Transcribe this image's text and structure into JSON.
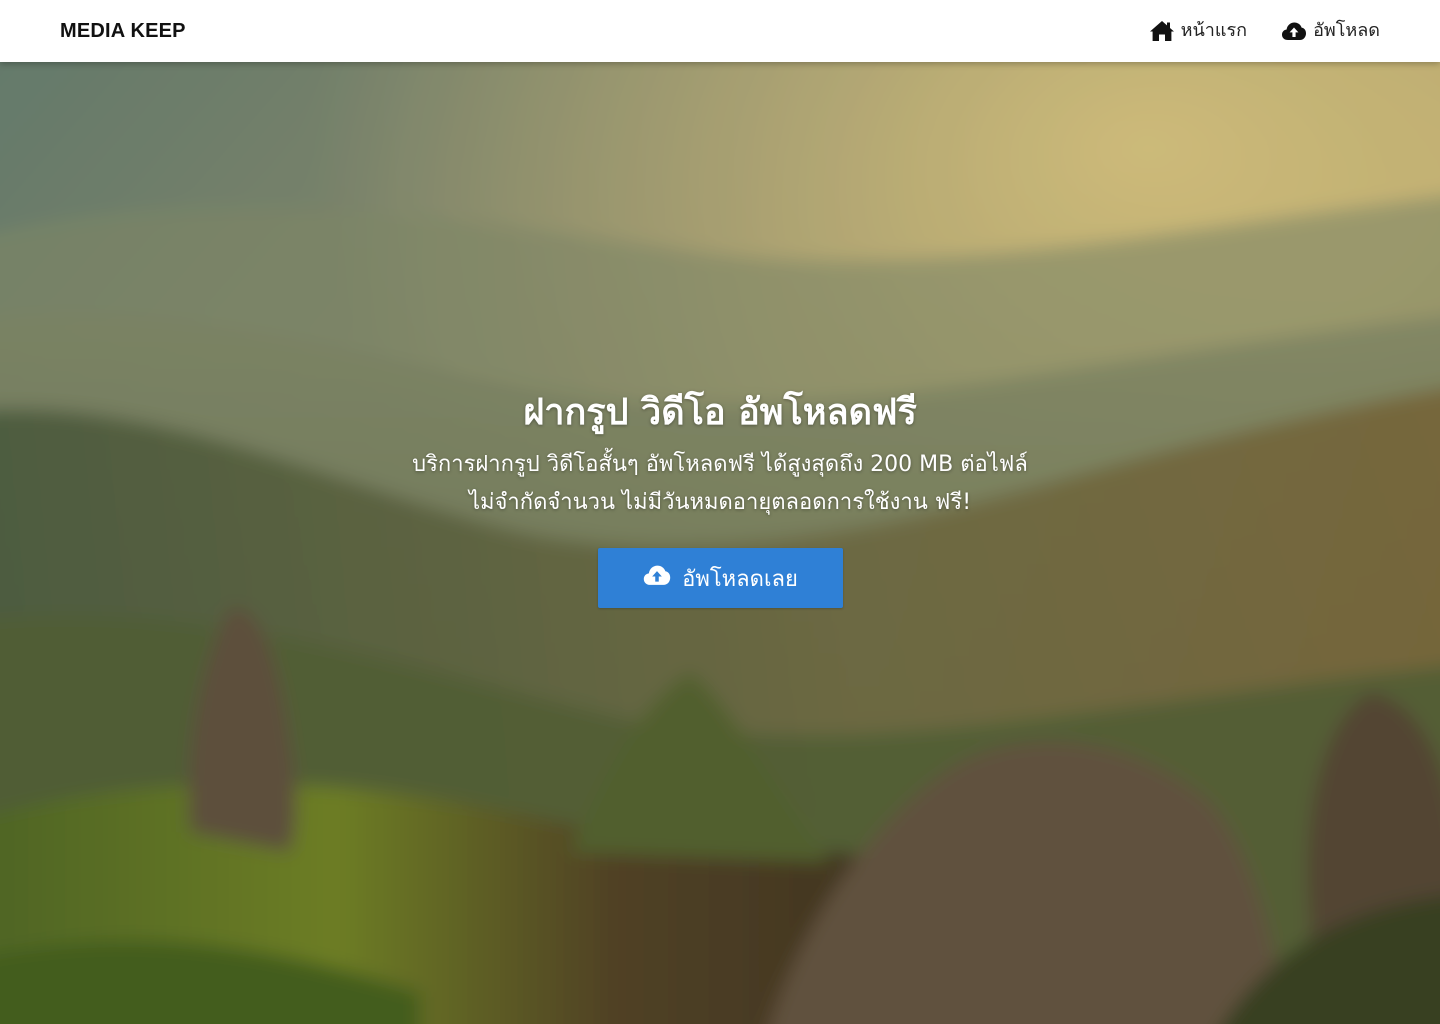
{
  "navbar": {
    "brand": "MEDIA KEEP",
    "links": [
      {
        "label": "หน้าแรก",
        "icon": "home-icon"
      },
      {
        "label": "อัพโหลด",
        "icon": "cloud-upload-icon"
      }
    ]
  },
  "hero": {
    "title": "ฝากรูป วิดีโอ อัพโหลดฟรี",
    "subtitle_line1": "บริการฝากรูป วิดีโอสั้นๆ อัพโหลดฟรี ได้สูงสุดถึง 200 MB  ต่อไฟล์",
    "subtitle_line2": "ไม่จำกัดจำนวน ไม่มีวันหมดอายุตลอดการใช้งาน ฟรี!",
    "cta_label": "อัพโหลดเลย",
    "cta_icon": "cloud-upload-icon",
    "background": "blurred-mountain-landscape-photo"
  },
  "colors": {
    "navbar_bg": "#ffffff",
    "cta_bg": "#2f80d6",
    "hero_text": "#ffffff"
  }
}
